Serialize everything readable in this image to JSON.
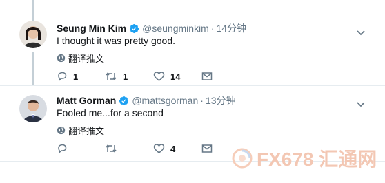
{
  "tweets": [
    {
      "name": "Seung Min Kim",
      "handle": "@seungminkim",
      "separator": "·",
      "time": "14分钟",
      "text": "I thought it was pretty good.",
      "translate": "翻译推文",
      "reply_count": "1",
      "retweet_count": "1",
      "like_count": "14"
    },
    {
      "name": "Matt Gorman",
      "handle": "@mattsgorman",
      "separator": "·",
      "time": "13分钟",
      "text": "Fooled me...for a second",
      "translate": "翻译推文",
      "reply_count": "",
      "retweet_count": "",
      "like_count": "4"
    }
  ],
  "watermark": {
    "text": "FX678 汇通网"
  },
  "colors": {
    "verified": "#1da1f2",
    "icon_gray": "#657786",
    "watermark": "#f3c7b3"
  }
}
